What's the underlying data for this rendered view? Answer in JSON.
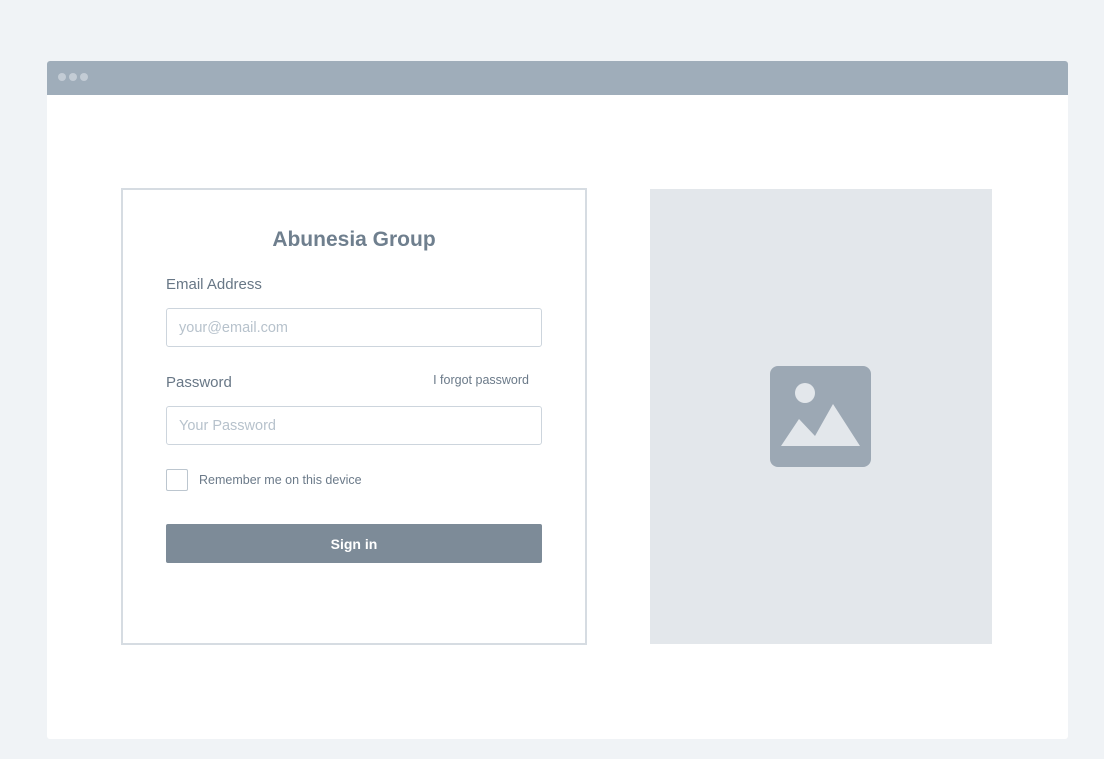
{
  "window": {
    "dots": [
      "dot",
      "dot",
      "dot"
    ]
  },
  "login": {
    "brand": "Abunesia Group",
    "email_label": "Email Address",
    "email_placeholder": "your@email.com",
    "email_value": "",
    "password_label": "Password",
    "forgot_link": "I forgot password",
    "password_placeholder": "Your Password",
    "password_value": "",
    "remember_label": "Remember me on this device",
    "remember_checked": false,
    "signin_label": "Sign in"
  },
  "image_panel": {
    "icon": "image-placeholder-icon"
  },
  "colors": {
    "titlebar": "#9fadba",
    "button": "#7d8b98",
    "panel": "#e3e7eb",
    "icon": "#9ca8b4"
  }
}
